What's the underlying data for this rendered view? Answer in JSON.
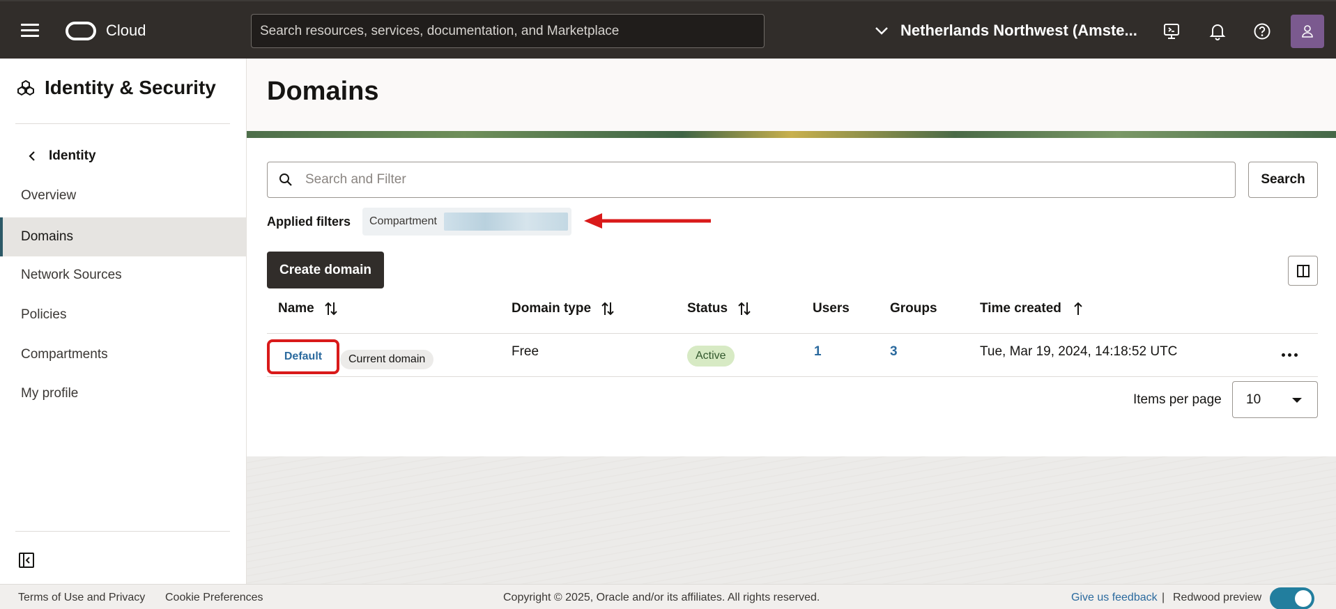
{
  "header": {
    "brand": "Cloud",
    "search_placeholder": "Search resources, services, documentation, and Marketplace",
    "region": "Netherlands Northwest (Amste..."
  },
  "sidebar": {
    "title": "Identity & Security",
    "back_label": "Identity",
    "items": [
      {
        "label": "Overview"
      },
      {
        "label": "Domains",
        "active": true
      },
      {
        "label": "Network Sources"
      },
      {
        "label": "Policies"
      },
      {
        "label": "Compartments"
      },
      {
        "label": "My profile"
      }
    ]
  },
  "main": {
    "title": "Domains",
    "search_placeholder": "Search and Filter",
    "search_button": "Search",
    "applied_filters_label": "Applied filters",
    "filter_chip_label": "Compartment",
    "create_button": "Create domain",
    "table": {
      "columns": [
        "Name",
        "Domain type",
        "Status",
        "Users",
        "Groups",
        "Time created"
      ],
      "rows": [
        {
          "name": "Default",
          "badge": "Current domain",
          "domain_type": "Free",
          "status": "Active",
          "users": "1",
          "groups": "3",
          "time_created": "Tue, Mar 19, 2024, 14:18:52 UTC"
        }
      ]
    },
    "items_per_page_label": "Items per page",
    "items_per_page_value": "10"
  },
  "footer": {
    "terms": "Terms of Use and Privacy",
    "cookies": "Cookie Preferences",
    "copyright": "Copyright © 2025, Oracle and/or its affiliates. All rights reserved.",
    "feedback": "Give us feedback",
    "separator": "|",
    "redwood": "Redwood preview"
  },
  "colors": {
    "header_bg": "#312d2a",
    "link": "#2b6a9e",
    "annotation_red": "#d91a1a",
    "toggle": "#227e9e"
  }
}
